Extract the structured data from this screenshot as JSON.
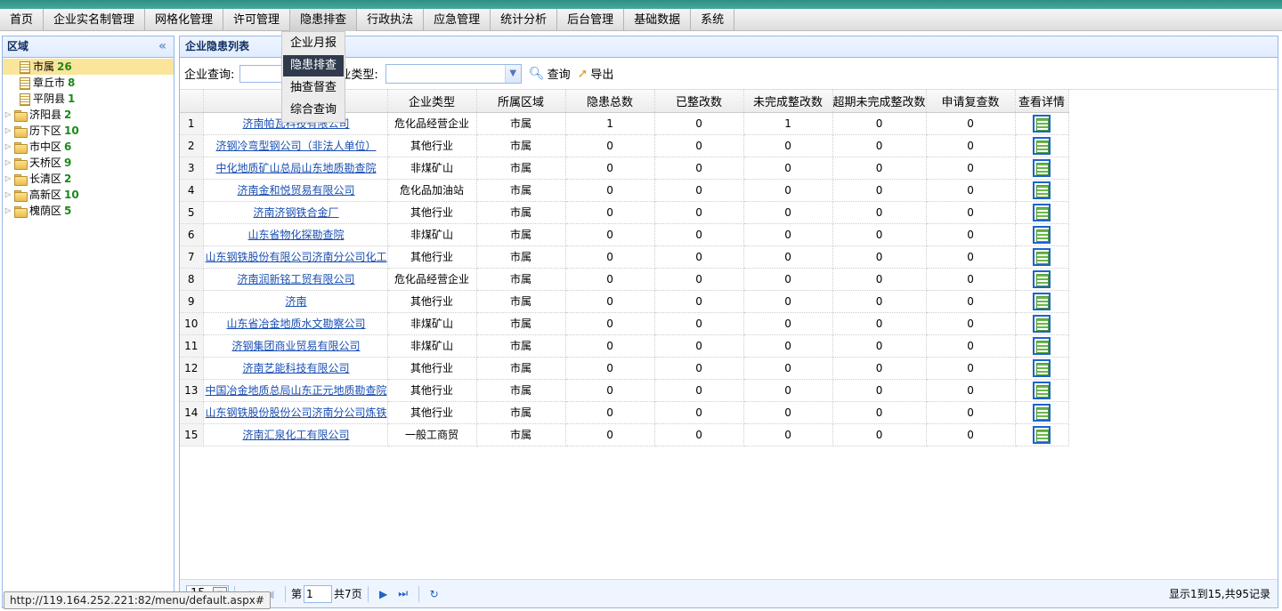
{
  "menu": {
    "items": [
      "首页",
      "企业实名制管理",
      "网格化管理",
      "许可管理",
      "隐患排查",
      "行政执法",
      "应急管理",
      "统计分析",
      "后台管理",
      "基础数据",
      "系统"
    ],
    "active_index": 4
  },
  "dropdown": {
    "items": [
      "企业月报",
      "隐患排查",
      "抽查督查",
      "综合查询"
    ],
    "selected_index": 1
  },
  "tree": {
    "title": "区域",
    "collapse_glyph": "«",
    "nodes": [
      {
        "label": "市属",
        "count": "26",
        "icon": "file-icon",
        "expandable": false,
        "selected": true
      },
      {
        "label": "章丘市",
        "count": "8",
        "icon": "file-icon",
        "expandable": false,
        "selected": false
      },
      {
        "label": "平阴县",
        "count": "1",
        "icon": "file-icon",
        "expandable": false,
        "selected": false
      },
      {
        "label": "济阳县",
        "count": "2",
        "icon": "folder-icon",
        "expandable": true,
        "selected": false
      },
      {
        "label": "历下区",
        "count": "10",
        "icon": "folder-icon",
        "expandable": true,
        "selected": false
      },
      {
        "label": "市中区",
        "count": "6",
        "icon": "folder-icon",
        "expandable": true,
        "selected": false
      },
      {
        "label": "天桥区",
        "count": "9",
        "icon": "folder-icon",
        "expandable": true,
        "selected": false
      },
      {
        "label": "长清区",
        "count": "2",
        "icon": "folder-icon",
        "expandable": true,
        "selected": false
      },
      {
        "label": "高新区",
        "count": "10",
        "icon": "folder-icon",
        "expandable": true,
        "selected": false
      },
      {
        "label": "槐荫区",
        "count": "5",
        "icon": "folder-icon",
        "expandable": true,
        "selected": false
      }
    ]
  },
  "main": {
    "title": "企业隐患列表",
    "search_label": "企业查询:",
    "search_value": "",
    "type_label": "业类型:",
    "type_value": "",
    "query_button": "查询",
    "export_button": "导出"
  },
  "table": {
    "columns": [
      "企",
      "企业类型",
      "所属区域",
      "隐患总数",
      "已整改数",
      "未完成整改数",
      "超期未完成整改数",
      "申请复查数",
      "查看详情"
    ],
    "rows": [
      {
        "n": "1",
        "name": "济南帕瓦科技有限公司",
        "type": "危化品经营企业",
        "region": "市属",
        "total": "1",
        "done": "0",
        "undone": "1",
        "overdue": "0",
        "recheck": "0"
      },
      {
        "n": "2",
        "name": "济钢冷弯型钢公司（非法人单位）",
        "type": "其他行业",
        "region": "市属",
        "total": "0",
        "done": "0",
        "undone": "0",
        "overdue": "0",
        "recheck": "0"
      },
      {
        "n": "3",
        "name": "中化地质矿山总局山东地质勘查院",
        "type": "非煤矿山",
        "region": "市属",
        "total": "0",
        "done": "0",
        "undone": "0",
        "overdue": "0",
        "recheck": "0"
      },
      {
        "n": "4",
        "name": "济南金和悦贸易有限公司",
        "type": "危化品加油站",
        "region": "市属",
        "total": "0",
        "done": "0",
        "undone": "0",
        "overdue": "0",
        "recheck": "0"
      },
      {
        "n": "5",
        "name": "济南济钢铁合金厂",
        "type": "其他行业",
        "region": "市属",
        "total": "0",
        "done": "0",
        "undone": "0",
        "overdue": "0",
        "recheck": "0"
      },
      {
        "n": "6",
        "name": "山东省物化探勘查院",
        "type": "非煤矿山",
        "region": "市属",
        "total": "0",
        "done": "0",
        "undone": "0",
        "overdue": "0",
        "recheck": "0"
      },
      {
        "n": "7",
        "name": "山东钢铁股份有限公司济南分公司化工",
        "type": "其他行业",
        "region": "市属",
        "total": "0",
        "done": "0",
        "undone": "0",
        "overdue": "0",
        "recheck": "0"
      },
      {
        "n": "8",
        "name": "济南润新铭工贸有限公司",
        "type": "危化品经营企业",
        "region": "市属",
        "total": "0",
        "done": "0",
        "undone": "0",
        "overdue": "0",
        "recheck": "0"
      },
      {
        "n": "9",
        "name": "济南",
        "type": "其他行业",
        "region": "市属",
        "total": "0",
        "done": "0",
        "undone": "0",
        "overdue": "0",
        "recheck": "0"
      },
      {
        "n": "10",
        "name": "山东省冶金地质水文勘察公司",
        "type": "非煤矿山",
        "region": "市属",
        "total": "0",
        "done": "0",
        "undone": "0",
        "overdue": "0",
        "recheck": "0"
      },
      {
        "n": "11",
        "name": "济钢集团商业贸易有限公司",
        "type": "非煤矿山",
        "region": "市属",
        "total": "0",
        "done": "0",
        "undone": "0",
        "overdue": "0",
        "recheck": "0"
      },
      {
        "n": "12",
        "name": "济南艺能科技有限公司",
        "type": "其他行业",
        "region": "市属",
        "total": "0",
        "done": "0",
        "undone": "0",
        "overdue": "0",
        "recheck": "0"
      },
      {
        "n": "13",
        "name": "中国冶金地质总局山东正元地质勘查院",
        "type": "其他行业",
        "region": "市属",
        "total": "0",
        "done": "0",
        "undone": "0",
        "overdue": "0",
        "recheck": "0"
      },
      {
        "n": "14",
        "name": "山东钢铁股份股份公司济南分公司炼铁",
        "type": "其他行业",
        "region": "市属",
        "total": "0",
        "done": "0",
        "undone": "0",
        "overdue": "0",
        "recheck": "0"
      },
      {
        "n": "15",
        "name": "济南汇泉化工有限公司",
        "type": "一般工商贸",
        "region": "市属",
        "total": "0",
        "done": "0",
        "undone": "0",
        "overdue": "0",
        "recheck": "0"
      }
    ]
  },
  "pager": {
    "page_size": "15",
    "page_prefix": "第",
    "page_value": "1",
    "page_suffix": "共7页",
    "info": "显示1到15,共95记录",
    "first_glyph": "⏮",
    "prev_glyph": "◀",
    "next_glyph": "▶",
    "last_glyph": "⏭",
    "refresh_glyph": "↻"
  },
  "status_bar": {
    "url": "http://119.164.252.221:82/menu/default.aspx#"
  },
  "colors": {
    "accent": "#2f8f86",
    "panel_border": "#95b8e7",
    "link": "#1a4fb3",
    "count_green": "#1a8a1a"
  }
}
